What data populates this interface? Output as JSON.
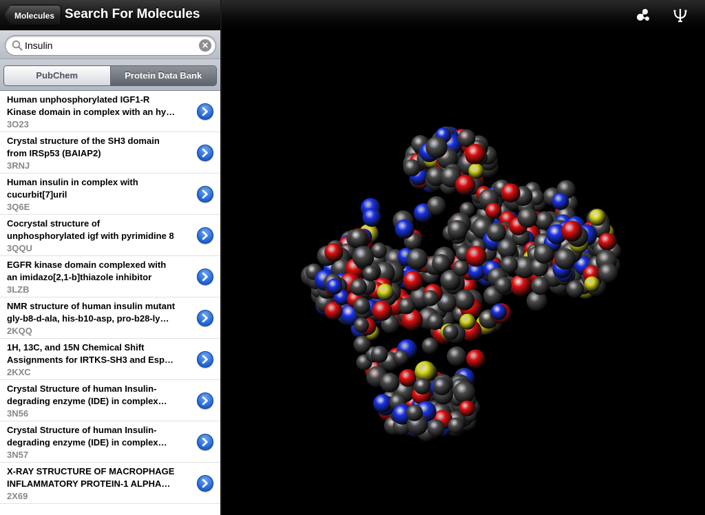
{
  "nav": {
    "back_label": "Molecules",
    "title": "Search For Molecules"
  },
  "search": {
    "value": "Insulin",
    "placeholder": ""
  },
  "segments": {
    "left_label": "PubChem",
    "right_label": "Protein Data Bank",
    "selected": "Protein Data Bank"
  },
  "results": [
    {
      "title": "Human unphosphorylated IGF1-R\nKinase domain in complex with an hy…",
      "id": "3O23"
    },
    {
      "title": "Crystal structure of the SH3 domain\nfrom IRSp53 (BAIAP2)",
      "id": "3RNJ"
    },
    {
      "title": "Human insulin in complex with\ncucurbit[7]uril",
      "id": "3Q6E"
    },
    {
      "title": "Cocrystal structure of\nunphosphorylated igf with pyrimidine 8",
      "id": "3QQU"
    },
    {
      "title": "EGFR kinase domain complexed with\nan imidazo[2,1-b]thiazole inhibitor",
      "id": "3LZB"
    },
    {
      "title": "NMR structure of human insulin mutant\ngly-b8-d-ala, his-b10-asp, pro-b28-ly…",
      "id": "2KQQ"
    },
    {
      "title": "1H, 13C, and 15N Chemical Shift\nAssignments for IRTKS-SH3 and Esp…",
      "id": "2KXC"
    },
    {
      "title": "Crystal Structure of human Insulin-\ndegrading enzyme (IDE) in complex…",
      "id": "3N56"
    },
    {
      "title": "Crystal Structure of human Insulin-\ndegrading enzyme (IDE) in complex…",
      "id": "3N57"
    },
    {
      "title": "X-RAY STRUCTURE OF MACROPHAGE\nINFLAMMATORY PROTEIN-1 ALPHA…",
      "id": "2X69"
    }
  ],
  "toolbar": {
    "icons": [
      "visualization-mode-icon",
      "surface-mode-icon"
    ]
  },
  "colors": {
    "carbon": "#4a4a4a",
    "oxygen": "#e01010",
    "nitrogen": "#1a33e6",
    "sulfur": "#d8d81a",
    "disclosure_blue": "#1d63d4"
  }
}
